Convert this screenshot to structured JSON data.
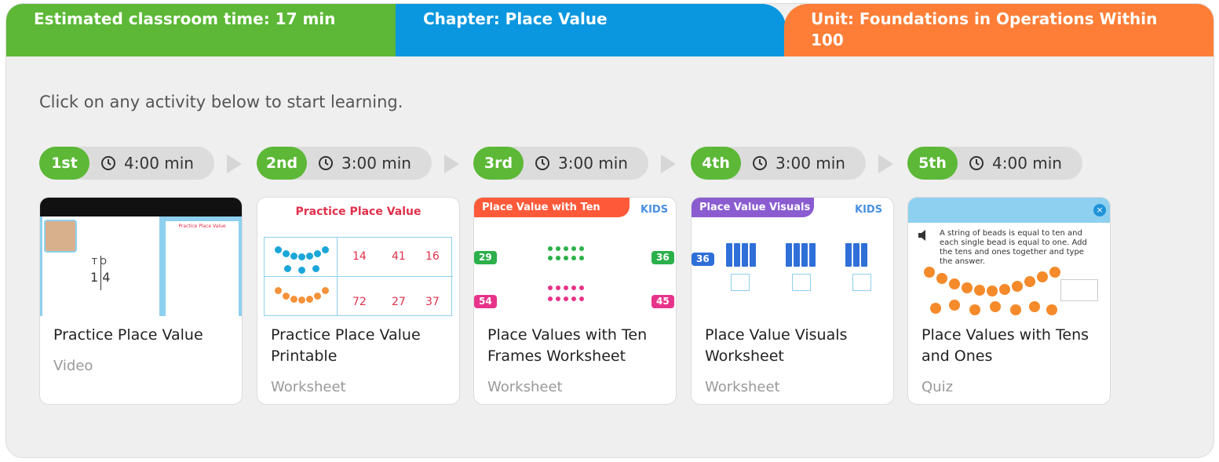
{
  "banner": {
    "time": "Estimated classroom time: 17 min",
    "chapter": "Chapter: Place Value",
    "unit": "Unit: Foundations in Operations Within 100"
  },
  "instruction": "Click on any activity below to start learning.",
  "colors": {
    "green": "#5cb836",
    "blue": "#0b97df",
    "orange": "#fe7e37",
    "panel": "#efefef"
  },
  "steps": [
    {
      "ordinal": "1st",
      "duration": "4:00 min"
    },
    {
      "ordinal": "2nd",
      "duration": "3:00 min"
    },
    {
      "ordinal": "3rd",
      "duration": "3:00 min"
    },
    {
      "ordinal": "4th",
      "duration": "3:00 min"
    },
    {
      "ordinal": "5th",
      "duration": "4:00 min"
    }
  ],
  "cards": [
    {
      "title": "Practice Place Value",
      "type": "Video",
      "thumb": {
        "sheet_title": "Practice Place Value",
        "tens_label": "T O",
        "number": "1 4"
      }
    },
    {
      "title": "Practice Place Value Printable",
      "type": "Worksheet",
      "thumb": {
        "heading": "Practice Place Value",
        "row1": [
          "14",
          "41",
          "16"
        ],
        "row2": [
          "72",
          "27",
          "37"
        ]
      }
    },
    {
      "title": "Place Values with Ten Frames Worksheet",
      "type": "Worksheet",
      "thumb": {
        "heading": "Place Value with Ten Frames",
        "logo": "KIDS",
        "left": [
          "29",
          "54"
        ],
        "right": [
          "36",
          "45"
        ]
      }
    },
    {
      "title": "Place Value Visuals Worksheet",
      "type": "Worksheet",
      "thumb": {
        "heading": "Place Value Visuals",
        "logo": "KIDS",
        "number": "36"
      }
    },
    {
      "title": "Place Values with Tens and Ones",
      "type": "Quiz",
      "thumb": {
        "prompt": "A string of beads is equal to ten and each single bead is equal to one. Add the tens and ones together and type the answer.",
        "close": "×"
      }
    }
  ]
}
